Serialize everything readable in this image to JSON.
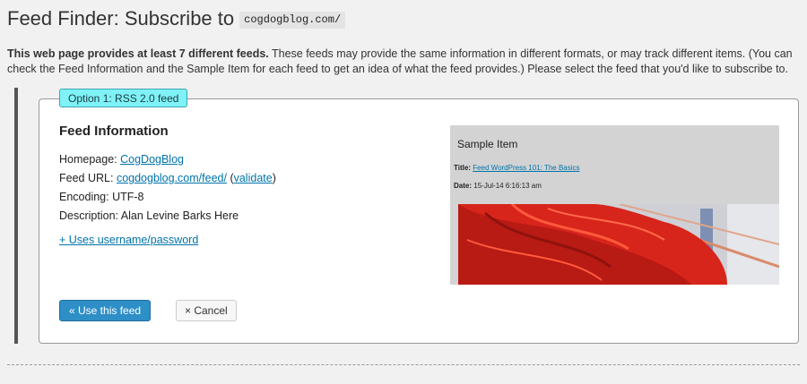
{
  "header": {
    "title": "Feed Finder: Subscribe to",
    "site": "cogdogblog.com/"
  },
  "intro": {
    "bold": "This web page provides at least 7 different feeds.",
    "text": " These feeds may provide the same information in different formats, or may track different items. (You can check the Feed Information and the Sample Item for each feed to get an idea of what the feed provides.) Please select the feed that you'd like to subscribe to."
  },
  "option": {
    "label": "Option 1: RSS 2.0 feed",
    "heading": "Feed Information",
    "homepage_label": "Homepage:",
    "homepage_value": "CogDogBlog",
    "feed_url_label": "Feed URL:",
    "feed_url_value": "cogdogblog.com/feed/",
    "validate_open": "(",
    "validate_label": "validate",
    "validate_close": ")",
    "encoding_label": "Encoding:",
    "encoding_value": "UTF-8",
    "description_label": "Description:",
    "description_value": "Alan Levine Barks Here",
    "uses_link": "+ Uses username/password"
  },
  "sample": {
    "heading": "Sample Item",
    "title_label": "Title:",
    "title_value": "Feed WordPress 101: The Basics",
    "date_label": "Date:",
    "date_value": "15-Jul-14 6:16:13 am"
  },
  "actions": {
    "use_label": "« Use this feed",
    "cancel_label": "× Cancel"
  },
  "colors": {
    "tab_bg": "#7ff2f7",
    "link": "#0073aa",
    "primary_button": "#2e8fc7",
    "hair": "#e8261a"
  }
}
